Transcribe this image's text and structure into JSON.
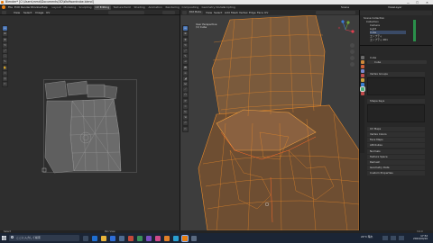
{
  "window": {
    "title": "Blender* [C:\\Users\\mmd\\Documents\\3D\\Wolfwardrobe.blend]",
    "minimize": "—",
    "maximize": "☐",
    "close": "✕"
  },
  "menubar": {
    "items": [
      "File",
      "Edit",
      "Render",
      "Window",
      "Help"
    ],
    "workspaces": [
      "Layout",
      "Modeling",
      "Sculpting",
      "UV Editing",
      "Texture Paint",
      "Shading",
      "Animation",
      "Rendering",
      "Compositing",
      "Geometry Nodes",
      "Scripting"
    ],
    "active_workspace": "UV Editing",
    "scene": "Scene",
    "view_layer": "ViewLayer"
  },
  "uv_editor": {
    "menus": [
      "View",
      "Select",
      "Image",
      "UV"
    ],
    "tools": [
      "cursor",
      "move",
      "rotate",
      "scale",
      "transform",
      "annotate",
      "grab",
      "relax",
      "pinch",
      "rip"
    ]
  },
  "viewport": {
    "mode": "Edit Mode",
    "menus": [
      "View",
      "Select",
      "Add",
      "Mesh",
      "Vertex",
      "Edge",
      "Face",
      "UV"
    ],
    "info_line1": "User Perspective",
    "info_line2": "(1) Cube"
  },
  "outliner": {
    "header": "Scene Collection",
    "rows": [
      {
        "name": "Collection",
        "icon": "collection-icon"
      },
      {
        "name": "Camera",
        "icon": "camera-icon"
      },
      {
        "name": "Light",
        "icon": "light-icon"
      },
      {
        "name": "Cube",
        "icon": "mesh-icon"
      },
      {
        "name": "エンプティ",
        "icon": "empty-icon"
      },
      {
        "name": "エンプティ.001",
        "icon": "empty-icon"
      }
    ]
  },
  "properties": {
    "object_name": "Cube",
    "mesh_name": "Cube",
    "sections": [
      "Vertex Groups",
      "Shape Keys",
      "UV Maps",
      "Vertex Colors",
      "Face Maps",
      "Attributes",
      "Normals",
      "Texture Space",
      "Remesh",
      "Geometry Data",
      "Custom Properties"
    ]
  },
  "statusbar": {
    "left": "Select",
    "mid": "Pan View",
    "right": "3.0.0"
  },
  "taskbar": {
    "search_placeholder": "ここに入力して検索",
    "temperature": "24°C 晴れ",
    "time": "17:52",
    "date": "2022/04/10"
  },
  "colors": {
    "accent": "#4772b3",
    "mesh_orange": "#e98a2a",
    "blender_orange": "#e87d0d"
  }
}
